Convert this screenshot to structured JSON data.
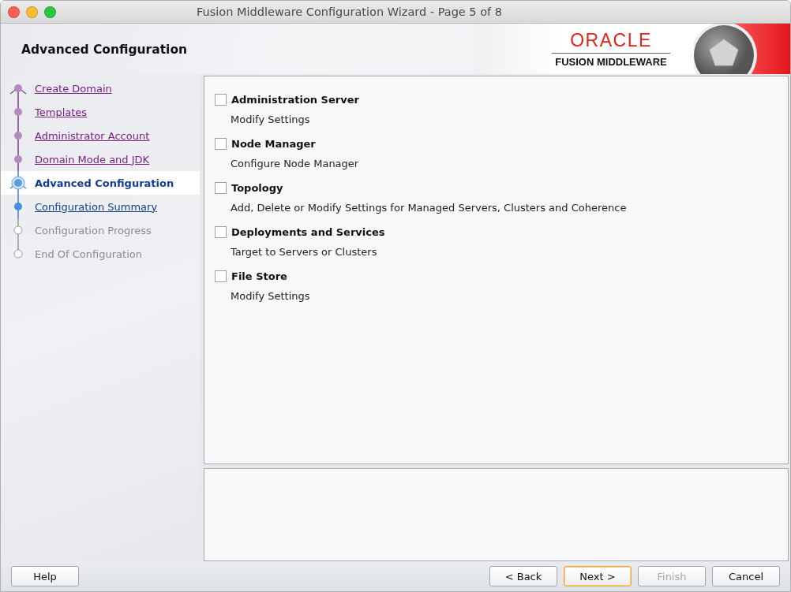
{
  "window": {
    "title": "Fusion Middleware Configuration Wizard - Page 5 of 8"
  },
  "header": {
    "title": "Advanced Configuration",
    "logo_brand": "ORACLE",
    "logo_product": "FUSION MIDDLEWARE"
  },
  "steps": [
    {
      "label": "Create Domain",
      "kind": "visited",
      "selected": false
    },
    {
      "label": "Templates",
      "kind": "visited",
      "selected": false
    },
    {
      "label": "Administrator Account",
      "kind": "visited",
      "selected": false
    },
    {
      "label": "Domain Mode and JDK",
      "kind": "visited",
      "selected": false
    },
    {
      "label": "Advanced Configuration",
      "kind": "current",
      "selected": true
    },
    {
      "label": "Configuration Summary",
      "kind": "next",
      "selected": false
    },
    {
      "label": "Configuration Progress",
      "kind": "future",
      "selected": false
    },
    {
      "label": "End Of Configuration",
      "kind": "future",
      "selected": false
    }
  ],
  "options": [
    {
      "label": "Administration Server",
      "description": "Modify Settings",
      "checked": false
    },
    {
      "label": "Node Manager",
      "description": "Configure Node Manager",
      "checked": false
    },
    {
      "label": "Topology",
      "description": "Add, Delete or Modify Settings for Managed Servers, Clusters and Coherence",
      "checked": false
    },
    {
      "label": "Deployments and Services",
      "description": "Target to Servers or Clusters",
      "checked": false
    },
    {
      "label": "File Store",
      "description": "Modify Settings",
      "checked": false
    }
  ],
  "buttons": {
    "help": {
      "label": "Help",
      "disabled": false
    },
    "actions": [
      {
        "label": "< Back",
        "disabled": false,
        "default": false
      },
      {
        "label": "Next >",
        "disabled": false,
        "default": true
      },
      {
        "label": "Finish",
        "disabled": true,
        "default": false
      },
      {
        "label": "Cancel",
        "disabled": false,
        "default": false
      }
    ]
  }
}
